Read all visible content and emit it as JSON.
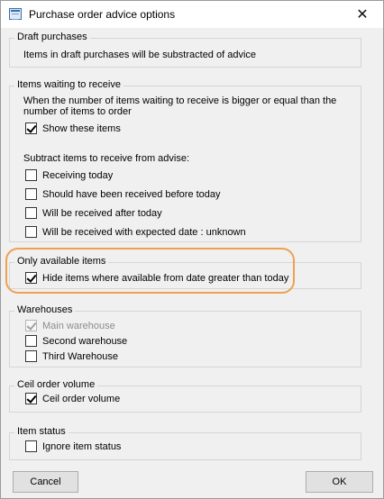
{
  "window": {
    "title": "Purchase order advice options",
    "close_glyph": "✕"
  },
  "draft": {
    "label": "Draft purchases",
    "text": "Items in draft purchases will be substracted of advice"
  },
  "waiting": {
    "label": "Items waiting to receive",
    "text_line1": "When the number of items waiting to receive is bigger or equal than the",
    "text_line2": "number of items to order",
    "show_items": {
      "label": "Show these items",
      "checked": true
    },
    "subtract_label": "Subtract items to receive from advise:",
    "options": [
      {
        "label": "Receiving today",
        "checked": false
      },
      {
        "label": "Should have been received before today",
        "checked": false
      },
      {
        "label": "Will be received after today",
        "checked": false
      },
      {
        "label": "Will be received with expected date : unknown",
        "checked": false
      }
    ]
  },
  "available": {
    "label": "Only available items",
    "hide_items": {
      "label": "Hide items where available from date greater than today",
      "checked": true
    },
    "highlight_color": "#f0a050"
  },
  "warehouses": {
    "label": "Warehouses",
    "items": [
      {
        "label": "Main warehouse",
        "checked": true,
        "disabled": true
      },
      {
        "label": "Second warehouse",
        "checked": false,
        "disabled": false
      },
      {
        "label": "Third Warehouse",
        "checked": false,
        "disabled": false
      }
    ]
  },
  "ceil": {
    "label": "Ceil order volume",
    "option": {
      "label": "Ceil order volume",
      "checked": true
    }
  },
  "status": {
    "label": "Item status",
    "option": {
      "label": "Ignore item status",
      "checked": false
    }
  },
  "buttons": {
    "cancel": "Cancel",
    "ok": "OK"
  }
}
